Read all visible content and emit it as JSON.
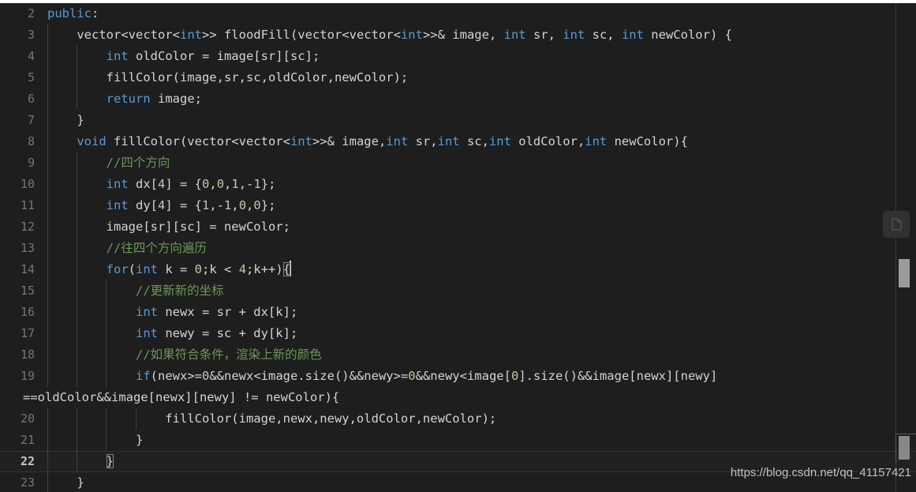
{
  "editor": {
    "theme": "dark-plus",
    "language": "cpp",
    "background_color": "#1e1e1e",
    "current_line_number": 22,
    "colors": {
      "keyword": "#569cd6",
      "comment": "#6a9955",
      "number": "#b5cea8",
      "text": "#d4d4d4",
      "line_number": "#6e7681",
      "line_number_active": "#c6c6c6",
      "indent_guide": "#404040",
      "current_line_bg": "#212121",
      "bracket_match_border": "#7a8a74",
      "scrollbar": "#9b9b9b"
    },
    "gutter": {
      "line_numbers": [
        "2",
        "3",
        "4",
        "5",
        "6",
        "7",
        "8",
        "9",
        "10",
        "11",
        "12",
        "13",
        "14",
        "15",
        "16",
        "17",
        "18",
        "19",
        "20",
        "21",
        "22",
        "23"
      ]
    },
    "lines": [
      {
        "number": "2",
        "indent_guides": 0,
        "text": "public:",
        "tokens": [
          {
            "t": "public",
            "c": "kw"
          },
          {
            "t": ":",
            "c": "plain"
          }
        ]
      },
      {
        "number": "3",
        "indent_guides": 1,
        "text": "    vector<vector<int>> floodFill(vector<vector<int>>& image, int sr, int sc, int newColor) {",
        "tokens": [
          {
            "t": "    vector<vector<",
            "c": "plain"
          },
          {
            "t": "int",
            "c": "kw"
          },
          {
            "t": ">> floodFill(vector<vector<",
            "c": "plain"
          },
          {
            "t": "int",
            "c": "kw"
          },
          {
            "t": ">>& image, ",
            "c": "plain"
          },
          {
            "t": "int",
            "c": "kw"
          },
          {
            "t": " sr, ",
            "c": "plain"
          },
          {
            "t": "int",
            "c": "kw"
          },
          {
            "t": " sc, ",
            "c": "plain"
          },
          {
            "t": "int",
            "c": "kw"
          },
          {
            "t": " newColor) {",
            "c": "plain"
          }
        ]
      },
      {
        "number": "4",
        "indent_guides": 2,
        "text": "        int oldColor = image[sr][sc];",
        "tokens": [
          {
            "t": "        ",
            "c": "plain"
          },
          {
            "t": "int",
            "c": "kw"
          },
          {
            "t": " oldColor = image[sr][sc];",
            "c": "plain"
          }
        ]
      },
      {
        "number": "5",
        "indent_guides": 2,
        "text": "        fillColor(image,sr,sc,oldColor,newColor);",
        "tokens": [
          {
            "t": "        fillColor(image,sr,sc,oldColor,newColor);",
            "c": "plain"
          }
        ]
      },
      {
        "number": "6",
        "indent_guides": 2,
        "text": "        return image;",
        "tokens": [
          {
            "t": "        ",
            "c": "plain"
          },
          {
            "t": "return",
            "c": "kw"
          },
          {
            "t": " image;",
            "c": "plain"
          }
        ]
      },
      {
        "number": "7",
        "indent_guides": 1,
        "text": "    }",
        "tokens": [
          {
            "t": "    }",
            "c": "plain"
          }
        ]
      },
      {
        "number": "8",
        "indent_guides": 1,
        "text": "    void fillColor(vector<vector<int>>& image,int sr,int sc,int oldColor,int newColor){",
        "tokens": [
          {
            "t": "    ",
            "c": "plain"
          },
          {
            "t": "void",
            "c": "kw"
          },
          {
            "t": " fillColor(vector<vector<",
            "c": "plain"
          },
          {
            "t": "int",
            "c": "kw"
          },
          {
            "t": ">>& image,",
            "c": "plain"
          },
          {
            "t": "int",
            "c": "kw"
          },
          {
            "t": " sr,",
            "c": "plain"
          },
          {
            "t": "int",
            "c": "kw"
          },
          {
            "t": " sc,",
            "c": "plain"
          },
          {
            "t": "int",
            "c": "kw"
          },
          {
            "t": " oldColor,",
            "c": "plain"
          },
          {
            "t": "int",
            "c": "kw"
          },
          {
            "t": " newColor){",
            "c": "plain"
          }
        ]
      },
      {
        "number": "9",
        "indent_guides": 2,
        "text": "        //四个方向",
        "tokens": [
          {
            "t": "        ",
            "c": "plain"
          },
          {
            "t": "//四个方向",
            "c": "cmt"
          }
        ]
      },
      {
        "number": "10",
        "indent_guides": 2,
        "text": "        int dx[4] = {0,0,1,-1};",
        "tokens": [
          {
            "t": "        ",
            "c": "plain"
          },
          {
            "t": "int",
            "c": "kw"
          },
          {
            "t": " dx[",
            "c": "plain"
          },
          {
            "t": "4",
            "c": "num"
          },
          {
            "t": "] = {",
            "c": "plain"
          },
          {
            "t": "0",
            "c": "num"
          },
          {
            "t": ",",
            "c": "plain"
          },
          {
            "t": "0",
            "c": "num"
          },
          {
            "t": ",",
            "c": "plain"
          },
          {
            "t": "1",
            "c": "num"
          },
          {
            "t": ",-",
            "c": "plain"
          },
          {
            "t": "1",
            "c": "num"
          },
          {
            "t": "};",
            "c": "plain"
          }
        ]
      },
      {
        "number": "11",
        "indent_guides": 2,
        "text": "        int dy[4] = {1,-1,0,0};",
        "tokens": [
          {
            "t": "        ",
            "c": "plain"
          },
          {
            "t": "int",
            "c": "kw"
          },
          {
            "t": " dy[",
            "c": "plain"
          },
          {
            "t": "4",
            "c": "num"
          },
          {
            "t": "] = {",
            "c": "plain"
          },
          {
            "t": "1",
            "c": "num"
          },
          {
            "t": ",-",
            "c": "plain"
          },
          {
            "t": "1",
            "c": "num"
          },
          {
            "t": ",",
            "c": "plain"
          },
          {
            "t": "0",
            "c": "num"
          },
          {
            "t": ",",
            "c": "plain"
          },
          {
            "t": "0",
            "c": "num"
          },
          {
            "t": "};",
            "c": "plain"
          }
        ]
      },
      {
        "number": "12",
        "indent_guides": 2,
        "text": "        image[sr][sc] = newColor;",
        "tokens": [
          {
            "t": "        image[sr][sc] = newColor;",
            "c": "plain"
          }
        ]
      },
      {
        "number": "13",
        "indent_guides": 2,
        "text": "        //往四个方向遍历",
        "tokens": [
          {
            "t": "        ",
            "c": "plain"
          },
          {
            "t": "//往四个方向遍历",
            "c": "cmt"
          }
        ]
      },
      {
        "number": "14",
        "indent_guides": 2,
        "text": "        for(int k = 0;k < 4;k++){",
        "tokens": [
          {
            "t": "        ",
            "c": "plain"
          },
          {
            "t": "for",
            "c": "kw"
          },
          {
            "t": "(",
            "c": "plain"
          },
          {
            "t": "int",
            "c": "kw"
          },
          {
            "t": " k = ",
            "c": "plain"
          },
          {
            "t": "0",
            "c": "num"
          },
          {
            "t": ";k < ",
            "c": "plain"
          },
          {
            "t": "4",
            "c": "num"
          },
          {
            "t": ";k++)",
            "c": "plain"
          },
          {
            "t": "{",
            "c": "plain",
            "bracket_match": true
          },
          {
            "t": "",
            "c": "caret"
          }
        ]
      },
      {
        "number": "15",
        "indent_guides": 3,
        "text": "            //更新新的坐标",
        "tokens": [
          {
            "t": "            ",
            "c": "plain"
          },
          {
            "t": "//更新新的坐标",
            "c": "cmt"
          }
        ]
      },
      {
        "number": "16",
        "indent_guides": 3,
        "text": "            int newx = sr + dx[k];",
        "tokens": [
          {
            "t": "            ",
            "c": "plain"
          },
          {
            "t": "int",
            "c": "kw"
          },
          {
            "t": " newx = sr + dx[k];",
            "c": "plain"
          }
        ]
      },
      {
        "number": "17",
        "indent_guides": 3,
        "text": "            int newy = sc + dy[k];",
        "tokens": [
          {
            "t": "            ",
            "c": "plain"
          },
          {
            "t": "int",
            "c": "kw"
          },
          {
            "t": " newy = sc + dy[k];",
            "c": "plain"
          }
        ]
      },
      {
        "number": "18",
        "indent_guides": 3,
        "text": "            //如果符合条件，渲染上新的颜色",
        "tokens": [
          {
            "t": "            ",
            "c": "plain"
          },
          {
            "t": "//如果符合条件，渲染上新的颜色",
            "c": "cmt"
          }
        ]
      },
      {
        "number": "19",
        "indent_guides": 3,
        "text": "            if(newx>=0&&newx<image.size()&&newy>=0&&newy<image[0].size()&&image[newx][newy]",
        "tokens": [
          {
            "t": "            ",
            "c": "plain"
          },
          {
            "t": "if",
            "c": "kw"
          },
          {
            "t": "(newx>=",
            "c": "plain"
          },
          {
            "t": "0",
            "c": "num"
          },
          {
            "t": "&&newx<image.size()&&newy>=",
            "c": "plain"
          },
          {
            "t": "0",
            "c": "num"
          },
          {
            "t": "&&newy<image[",
            "c": "plain"
          },
          {
            "t": "0",
            "c": "num"
          },
          {
            "t": "].size()&&image[newx][newy]",
            "c": "plain"
          }
        ]
      },
      {
        "number": "",
        "wrapped": true,
        "indent_guides": 0,
        "text": "==oldColor&&image[newx][newy] != newColor){",
        "tokens": [
          {
            "t": "==oldColor&&image[newx][newy] != newColor){",
            "c": "plain"
          }
        ]
      },
      {
        "number": "20",
        "indent_guides": 4,
        "text": "                fillColor(image,newx,newy,oldColor,newColor);",
        "tokens": [
          {
            "t": "                fillColor(image,newx,newy,oldColor,newColor);",
            "c": "plain"
          }
        ]
      },
      {
        "number": "21",
        "indent_guides": 3,
        "text": "            }",
        "tokens": [
          {
            "t": "            }",
            "c": "plain"
          }
        ]
      },
      {
        "number": "22",
        "indent_guides": 2,
        "current": true,
        "text": "        }",
        "tokens": [
          {
            "t": "        ",
            "c": "plain"
          },
          {
            "t": "}",
            "c": "plain",
            "bracket_match": true
          }
        ]
      },
      {
        "number": "23",
        "indent_guides": 1,
        "text": "    }",
        "tokens": [
          {
            "t": "    }",
            "c": "plain"
          }
        ]
      }
    ]
  },
  "overlay": {
    "copy_button_icon": "page-copy-icon"
  },
  "scrollbar": {
    "vertical_slider_label": "vertical-scrollbar-slider"
  },
  "watermark": {
    "text": "https://blog.csdn.net/qq_41157421"
  }
}
